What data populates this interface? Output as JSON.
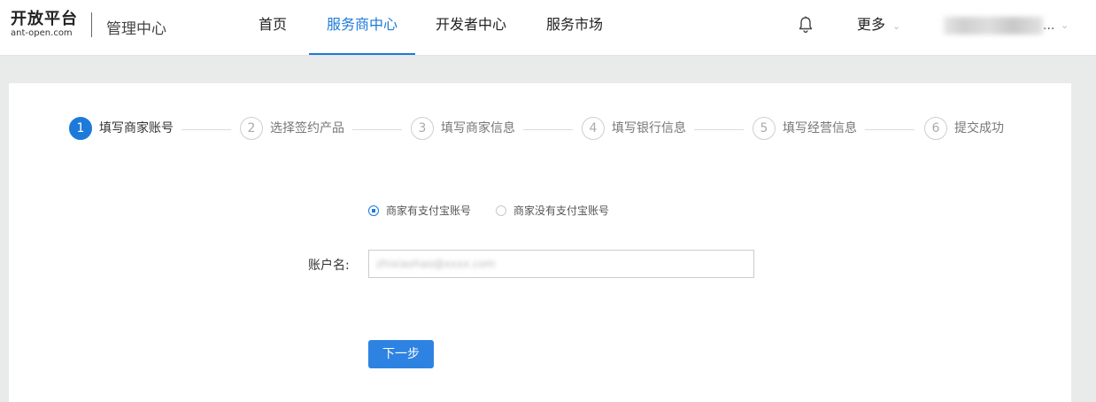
{
  "header": {
    "logo_main": "开放平台",
    "logo_sub": "ant-open.com",
    "console_title": "管理中心",
    "nav": [
      "首页",
      "服务商中心",
      "开发者中心",
      "服务市场"
    ],
    "active_nav": "服务商中心",
    "more_label": "更多",
    "user_name_suffix": "..."
  },
  "steps": [
    {
      "num": "1",
      "label": "填写商家账号"
    },
    {
      "num": "2",
      "label": "选择签约产品"
    },
    {
      "num": "3",
      "label": "填写商家信息"
    },
    {
      "num": "4",
      "label": "填写银行信息"
    },
    {
      "num": "5",
      "label": "填写经营信息"
    },
    {
      "num": "6",
      "label": "提交成功"
    }
  ],
  "form": {
    "radio_options": [
      "商家有支付宝账号",
      "商家没有支付宝账号"
    ],
    "selected_radio": "商家有支付宝账号",
    "account_label": "账户名:",
    "account_value": "zhixiaohao@xxxx.com",
    "next_button": "下一步"
  },
  "colors": {
    "accent": "#1d7ad9",
    "button": "#2e83e2"
  }
}
